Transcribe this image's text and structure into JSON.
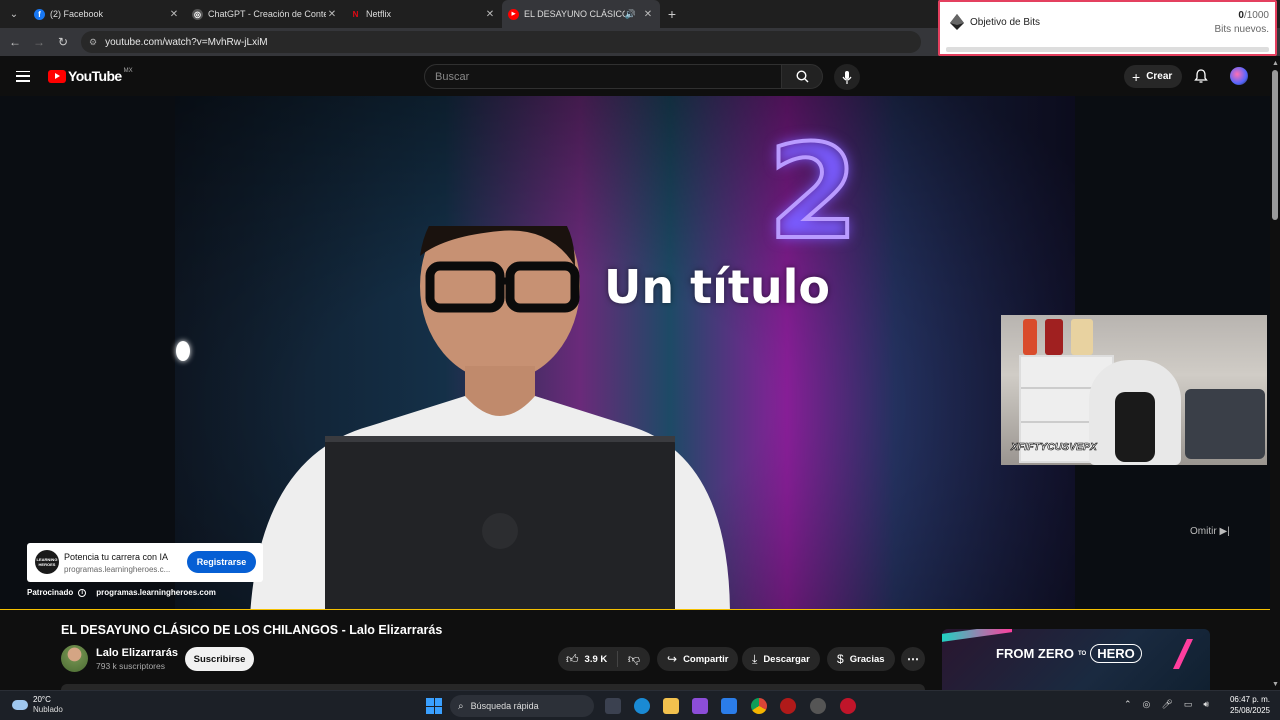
{
  "browser": {
    "tabs": [
      {
        "title": "(2) Facebook",
        "favicon_color": "#1877f2",
        "favicon_glyph": "f",
        "active": false
      },
      {
        "title": "ChatGPT - Creación de Conten",
        "favicon_color": "#555555",
        "favicon_glyph": "◎",
        "active": false
      },
      {
        "title": "Netflix",
        "favicon_color": "#e50914",
        "favicon_glyph": "N",
        "active": false
      },
      {
        "title": "EL DESAYUNO CLÁSICO DE",
        "favicon_color": "#ff0000",
        "favicon_glyph": "▶",
        "active": true
      }
    ],
    "url": "youtube.com/watch?v=MvhRw-jLxiM"
  },
  "bits_widget": {
    "label": "Objetivo de Bits",
    "count": "0",
    "goal": "/1000",
    "sub": "Bits nuevos.",
    "progress": 0
  },
  "youtube": {
    "logo_word": "YouTube",
    "country": "MX",
    "search_placeholder": "Buscar",
    "create_label": "Crear"
  },
  "video": {
    "overlay_number": "2",
    "overlay_title": "Un título",
    "skip_label": "Omitir",
    "webcam_tag": "XFIFTYCUSVEPX",
    "ad": {
      "logo_text": "LEARNING HEROES",
      "headline": "Potencia tu carrera con IA",
      "url": "programas.learningheroes.c...",
      "cta": "Registrarse",
      "sponsored_label": "Patrocinado",
      "sponsor_domain": "programas.learningheroes.com"
    }
  },
  "watch": {
    "title": "EL DESAYUNO CLÁSICO DE LOS CHILANGOS - Lalo Elizarrarás",
    "channel_name": "Lalo Elizarrarás",
    "subscribers": "793 k suscriptores",
    "subscribe_label": "Suscribirse",
    "likes": "3.9 K",
    "share_label": "Compartir",
    "download_label": "Descargar",
    "thanks_label": "Gracias"
  },
  "side_ad": {
    "word1": "FROM ZERO",
    "word2": "TO",
    "word3": "HERO"
  },
  "taskbar": {
    "temperature": "20°C",
    "condition": "Nublado",
    "search_label": "Búsqueda rápida",
    "time": "06:47 p. m.",
    "date": "25/08/2025"
  }
}
